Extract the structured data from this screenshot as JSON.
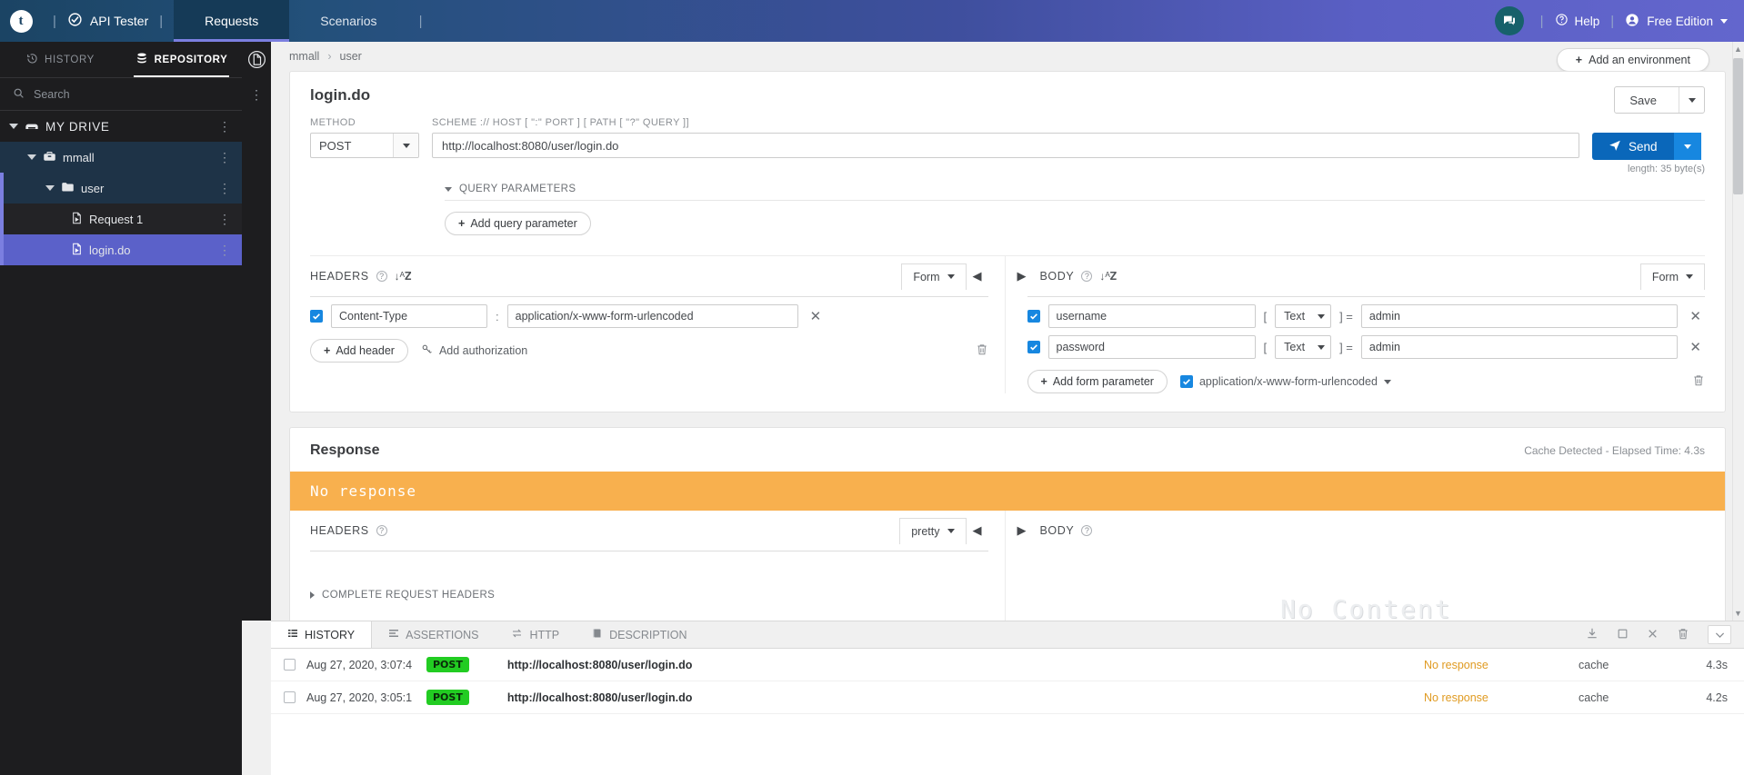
{
  "topbar": {
    "logo_letter": "t",
    "product_name": "API Tester",
    "tabs": [
      {
        "label": "Requests",
        "active": true
      },
      {
        "label": "Scenarios",
        "active": false
      }
    ],
    "help_label": "Help",
    "edition_label": "Free Edition",
    "icons": {
      "chat": "chat-icon",
      "help": "question-circle-icon",
      "user": "user-avatar-icon"
    }
  },
  "sidebar": {
    "tabs": [
      {
        "label": "HISTORY",
        "icon": "clock-icon",
        "active": false
      },
      {
        "label": "REPOSITORY",
        "icon": "database-icon",
        "active": true
      }
    ],
    "search_placeholder": "Search",
    "tree": [
      {
        "label": "MY DRIVE",
        "level": 0,
        "icon": "drive-icon",
        "expanded": true,
        "selected": false
      },
      {
        "label": "mmall",
        "level": 1,
        "icon": "briefcase-icon",
        "expanded": true,
        "selected": false
      },
      {
        "label": "user",
        "level": 2,
        "icon": "folder-icon",
        "expanded": true,
        "selected": false
      },
      {
        "label": "Request 1",
        "level": 3,
        "icon": "request-icon",
        "expanded": false,
        "selected": false
      },
      {
        "label": "login.do",
        "level": 3,
        "icon": "request-icon",
        "expanded": false,
        "selected": true
      }
    ]
  },
  "breadcrumb": {
    "items": [
      "mmall",
      "user"
    ],
    "separator": "›"
  },
  "environment": {
    "add_label": "Add an environment"
  },
  "request": {
    "title": "login.do",
    "method_label": "METHOD",
    "method_value": "POST",
    "url_label": "SCHEME :// HOST [ \":\" PORT ] [ PATH [ \"?\" QUERY ]]",
    "url_value": "http://localhost:8080/user/login.do",
    "length_note": "length: 35 byte(s)",
    "save_label": "Save",
    "send_label": "Send",
    "query_parameters_label": "QUERY PARAMETERS",
    "add_query_parameter_label": "Add query parameter",
    "headers": {
      "title": "HEADERS",
      "mode": "Form",
      "rows": [
        {
          "enabled": true,
          "key": "Content-Type",
          "value": "application/x-www-form-urlencoded"
        }
      ],
      "add_header_label": "Add header",
      "add_authorization_label": "Add authorization"
    },
    "body": {
      "title": "BODY",
      "mode": "Form",
      "rows": [
        {
          "enabled": true,
          "key": "username",
          "type": "Text",
          "value": "admin"
        },
        {
          "enabled": true,
          "key": "password",
          "type": "Text",
          "value": "admin"
        }
      ],
      "add_form_parameter_label": "Add form parameter",
      "content_type_enabled": true,
      "content_type_label": "application/x-www-form-urlencoded"
    }
  },
  "response": {
    "title": "Response",
    "meta": "Cache Detected - Elapsed Time: 4.3s",
    "banner_text": "No response",
    "banner_color": "#f8b04e",
    "headers": {
      "title": "HEADERS",
      "mode": "pretty",
      "complete_request_headers_label": "COMPLETE REQUEST HEADERS"
    },
    "body": {
      "title": "BODY",
      "placeholder": "No Content"
    }
  },
  "bottom_panel": {
    "tabs": [
      {
        "label": "HISTORY",
        "icon": "list-icon",
        "active": true
      },
      {
        "label": "ASSERTIONS",
        "icon": "assertions-icon",
        "active": false
      },
      {
        "label": "HTTP",
        "icon": "exchange-icon",
        "active": false
      },
      {
        "label": "DESCRIPTION",
        "icon": "book-icon",
        "active": false
      }
    ],
    "toolbar_icons": [
      "download-icon",
      "select-all-icon",
      "clear-icon",
      "trash-icon",
      "chevron-down-icon"
    ],
    "rows": [
      {
        "timestamp": "Aug 27, 2020, 3:07:4",
        "method": "POST",
        "url": "http://localhost:8080/user/login.do",
        "status": "No response",
        "source": "cache",
        "time": "4.3s"
      },
      {
        "timestamp": "Aug 27, 2020, 3:05:1",
        "method": "POST",
        "url": "http://localhost:8080/user/login.do",
        "status": "No response",
        "source": "cache",
        "time": "4.2s"
      }
    ]
  },
  "colors": {
    "accent_blue": "#0a67ba",
    "accent_purple": "#5b61c9",
    "warning_orange": "#f8b04e",
    "method_green": "#22cc22",
    "sidebar_dark": "#1d1d1f"
  }
}
